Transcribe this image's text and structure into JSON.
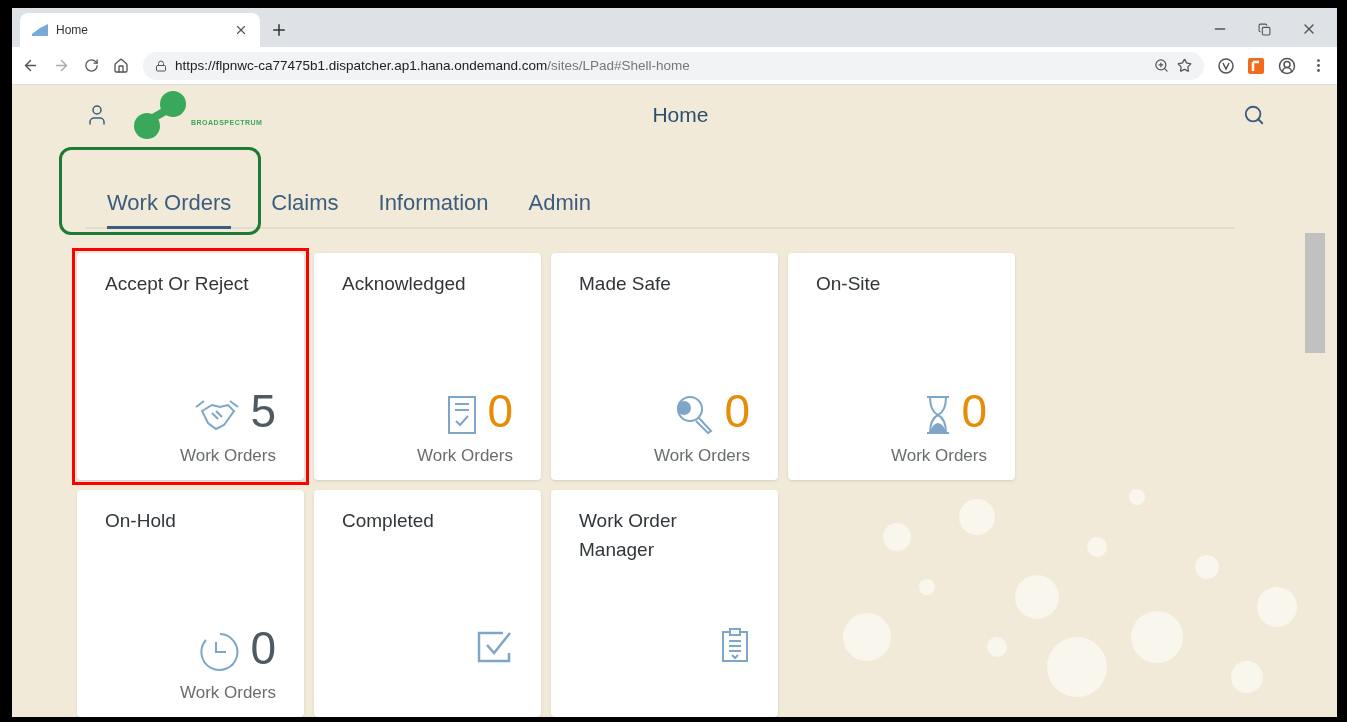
{
  "browser": {
    "tab_title": "Home",
    "url_host": "https://flpnwc-ca77475b1.dispatcher.ap1.hana.ondemand.com",
    "url_path": "/sites/LPad#Shell-home"
  },
  "header": {
    "logo_text": "BROADSPECTRUM",
    "title": "Home"
  },
  "tabs": [
    {
      "label": "Work Orders",
      "selected": true,
      "highlighted": true
    },
    {
      "label": "Claims",
      "selected": false,
      "highlighted": false
    },
    {
      "label": "Information",
      "selected": false,
      "highlighted": false
    },
    {
      "label": "Admin",
      "selected": false,
      "highlighted": false
    }
  ],
  "tiles": [
    {
      "title": "Accept Or Reject",
      "number": "5",
      "color": "#4e5a62",
      "footer": "Work Orders",
      "highlighted": true
    },
    {
      "title": "Acknowledged",
      "number": "0",
      "color": "#e78c07",
      "footer": "Work Orders",
      "highlighted": false
    },
    {
      "title": "Made Safe",
      "number": "0",
      "color": "#e78c07",
      "footer": "Work Orders",
      "highlighted": false
    },
    {
      "title": "On-Site",
      "number": "0",
      "color": "#e78c07",
      "footer": "Work Orders",
      "highlighted": false
    },
    {
      "title": "On-Hold",
      "number": "0",
      "color": "#4e5a62",
      "footer": "Work Orders",
      "highlighted": false
    },
    {
      "title": "Completed",
      "highlighted": false
    },
    {
      "title": "Work Order Manager",
      "highlighted": false
    }
  ]
}
